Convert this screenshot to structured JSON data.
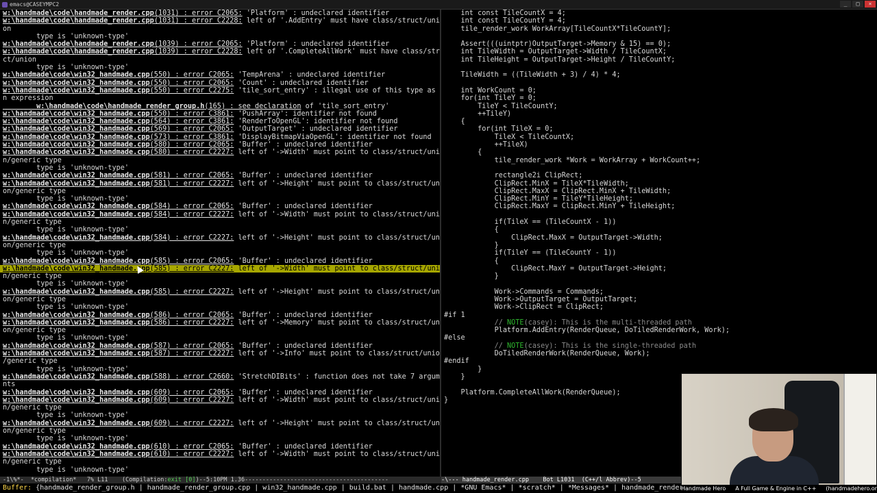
{
  "window": {
    "title": "emacs@CASEYMPC2",
    "btn_min": "_",
    "btn_max": "□",
    "btn_close": "×"
  },
  "left_lines": [
    {
      "t": "err",
      "path": "w:\\handmade\\code\\handmade_render.cpp",
      "loc": "(1031) : error C2065:",
      "msg": " 'Platform' : undeclared identifier"
    },
    {
      "t": "err",
      "path": "w:\\handmade\\code\\handmade_render.cpp",
      "loc": "(1031) : error C2228:",
      "msg": " left of '.AddEntry' must have class/struct/union"
    },
    {
      "t": "txt",
      "text": "on"
    },
    {
      "t": "txt",
      "text": "        type is 'unknown-type'"
    },
    {
      "t": "err",
      "path": "w:\\handmade\\code\\handmade_render.cpp",
      "loc": "(1039) : error C2065:",
      "msg": " 'Platform' : undeclared identifier"
    },
    {
      "t": "err",
      "path": "w:\\handmade\\code\\handmade_render.cpp",
      "loc": "(1039) : error C2228:",
      "msg": " left of '.CompleteAllWork' must have class/stru"
    },
    {
      "t": "txt",
      "text": "ct/union"
    },
    {
      "t": "txt",
      "text": "        type is 'unknown-type'"
    },
    {
      "t": "err",
      "path": "w:\\handmade\\code\\win32_handmade.cpp",
      "loc": "(550) : error C2065:",
      "msg": " 'TempArena' : undeclared identifier"
    },
    {
      "t": "err",
      "path": "w:\\handmade\\code\\win32_handmade.cpp",
      "loc": "(550) : error C2065:",
      "msg": " 'Count' : undeclared identifier"
    },
    {
      "t": "err",
      "path": "w:\\handmade\\code\\win32_handmade.cpp",
      "loc": "(550) : error C2275:",
      "msg": " 'tile_sort_entry' : illegal use of this type as a"
    },
    {
      "t": "txt",
      "text": "n expression"
    },
    {
      "t": "err",
      "path": "        w:\\handmade\\code\\handmade_render_group.h",
      "loc": "(165) : see declaration",
      "msg": " of 'tile_sort_entry'"
    },
    {
      "t": "err",
      "path": "w:\\handmade\\code\\win32_handmade.cpp",
      "loc": "(550) : error C3861:",
      "msg": " 'PushArray': identifier not found"
    },
    {
      "t": "err",
      "path": "w:\\handmade\\code\\win32_handmade.cpp",
      "loc": "(564) : error C3861:",
      "msg": " 'RenderToOpenGL': identifier not found"
    },
    {
      "t": "err",
      "path": "w:\\handmade\\code\\win32_handmade.cpp",
      "loc": "(569) : error C2065:",
      "msg": " 'OutputTarget' : undeclared identifier"
    },
    {
      "t": "err",
      "path": "w:\\handmade\\code\\win32_handmade.cpp",
      "loc": "(573) : error C3861:",
      "msg": " 'DisplayBitmapViaOpenGL': identifier not found"
    },
    {
      "t": "err",
      "path": "w:\\handmade\\code\\win32_handmade.cpp",
      "loc": "(580) : error C2065:",
      "msg": " 'Buffer' : undeclared identifier"
    },
    {
      "t": "err",
      "path": "w:\\handmade\\code\\win32_handmade.cpp",
      "loc": "(580) : error C2227:",
      "msg": " left of '->Width' must point to class/struct/unio"
    },
    {
      "t": "txt",
      "text": "n/generic type"
    },
    {
      "t": "txt",
      "text": "        type is 'unknown-type'"
    },
    {
      "t": "err",
      "path": "w:\\handmade\\code\\win32_handmade.cpp",
      "loc": "(581) : error C2065:",
      "msg": " 'Buffer' : undeclared identifier"
    },
    {
      "t": "err",
      "path": "w:\\handmade\\code\\win32_handmade.cpp",
      "loc": "(581) : error C2227:",
      "msg": " left of '->Height' must point to class/struct/uni"
    },
    {
      "t": "txt",
      "text": "on/generic type"
    },
    {
      "t": "txt",
      "text": "        type is 'unknown-type'"
    },
    {
      "t": "err",
      "path": "w:\\handmade\\code\\win32_handmade.cpp",
      "loc": "(584) : error C2065:",
      "msg": " 'Buffer' : undeclared identifier"
    },
    {
      "t": "err",
      "path": "w:\\handmade\\code\\win32_handmade.cpp",
      "loc": "(584) : error C2227:",
      "msg": " left of '->Width' must point to class/struct/unio"
    },
    {
      "t": "txt",
      "text": "n/generic type"
    },
    {
      "t": "txt",
      "text": "        type is 'unknown-type'"
    },
    {
      "t": "err",
      "path": "w:\\handmade\\code\\win32_handmade.cpp",
      "loc": "(584) : error C2227:",
      "msg": " left of '->Height' must point to class/struct/uni"
    },
    {
      "t": "txt",
      "text": "on/generic type"
    },
    {
      "t": "txt",
      "text": "        type is 'unknown-type'"
    },
    {
      "t": "err",
      "path": "w:\\handmade\\code\\win32_handmade.cpp",
      "loc": "(585) : error C2065:",
      "msg": " 'Buffer' : undeclared identifier"
    },
    {
      "t": "err",
      "hl": true,
      "path": "w:\\handmade\\code\\win32_handmade.cpp",
      "loc": "(585) : error C2227:",
      "msg": " left of '->Width' must point to class/struct/unio"
    },
    {
      "t": "txt",
      "text": "n/generic type"
    },
    {
      "t": "txt",
      "text": "        type is 'unknown-type'"
    },
    {
      "t": "err",
      "path": "w:\\handmade\\code\\win32_handmade.cpp",
      "loc": "(585) : error C2227:",
      "msg": " left of '->Height' must point to class/struct/uni"
    },
    {
      "t": "txt",
      "text": "on/generic type"
    },
    {
      "t": "txt",
      "text": "        type is 'unknown-type'"
    },
    {
      "t": "err",
      "path": "w:\\handmade\\code\\win32_handmade.cpp",
      "loc": "(586) : error C2065:",
      "msg": " 'Buffer' : undeclared identifier"
    },
    {
      "t": "err",
      "path": "w:\\handmade\\code\\win32_handmade.cpp",
      "loc": "(586) : error C2227:",
      "msg": " left of '->Memory' must point to class/struct/uni"
    },
    {
      "t": "txt",
      "text": "on/generic type"
    },
    {
      "t": "txt",
      "text": "        type is 'unknown-type'"
    },
    {
      "t": "err",
      "path": "w:\\handmade\\code\\win32_handmade.cpp",
      "loc": "(587) : error C2065:",
      "msg": " 'Buffer' : undeclared identifier"
    },
    {
      "t": "err",
      "path": "w:\\handmade\\code\\win32_handmade.cpp",
      "loc": "(587) : error C2227:",
      "msg": " left of '->Info' must point to class/struct/union"
    },
    {
      "t": "txt",
      "text": "/generic type"
    },
    {
      "t": "txt",
      "text": "        type is 'unknown-type'"
    },
    {
      "t": "err",
      "path": "w:\\handmade\\code\\win32_handmade.cpp",
      "loc": "(588) : error C2660:",
      "msg": " 'StretchDIBits' : function does not take 7 argume"
    },
    {
      "t": "txt",
      "text": "nts"
    },
    {
      "t": "err",
      "path": "w:\\handmade\\code\\win32_handmade.cpp",
      "loc": "(609) : error C2065:",
      "msg": " 'Buffer' : undeclared identifier"
    },
    {
      "t": "err",
      "path": "w:\\handmade\\code\\win32_handmade.cpp",
      "loc": "(609) : error C2227:",
      "msg": " left of '->Width' must point to class/struct/unio"
    },
    {
      "t": "txt",
      "text": "n/generic type"
    },
    {
      "t": "txt",
      "text": "        type is 'unknown-type'"
    },
    {
      "t": "err",
      "path": "w:\\handmade\\code\\win32_handmade.cpp",
      "loc": "(609) : error C2227:",
      "msg": " left of '->Height' must point to class/struct/uni"
    },
    {
      "t": "txt",
      "text": "on/generic type"
    },
    {
      "t": "txt",
      "text": "        type is 'unknown-type'"
    },
    {
      "t": "err",
      "path": "w:\\handmade\\code\\win32_handmade.cpp",
      "loc": "(610) : error C2065:",
      "msg": " 'Buffer' : undeclared identifier"
    },
    {
      "t": "err",
      "path": "w:\\handmade\\code\\win32_handmade.cpp",
      "loc": "(610) : error C2227:",
      "msg": " left of '->Width' must point to class/struct/unio"
    },
    {
      "t": "txt",
      "text": "n/generic type"
    },
    {
      "t": "txt",
      "text": "        type is 'unknown-type'"
    }
  ],
  "right_lines": [
    {
      "text": "    int const TileCountX = 4;"
    },
    {
      "text": "    int const TileCountY = 4;"
    },
    {
      "text": "    tile_render_work WorkArray[TileCountX*TileCountY];"
    },
    {
      "text": ""
    },
    {
      "text": "    Assert(((uintptr)OutputTarget->Memory & 15) == 0);"
    },
    {
      "text": "    int TileWidth = OutputTarget->Width / TileCountX;"
    },
    {
      "text": "    int TileHeight = OutputTarget->Height / TileCountY;"
    },
    {
      "text": ""
    },
    {
      "text": "    TileWidth = ((TileWidth + 3) / 4) * 4;"
    },
    {
      "text": ""
    },
    {
      "text": "    int WorkCount = 0;"
    },
    {
      "text": "    for(int TileY = 0;"
    },
    {
      "text": "        TileY < TileCountY;"
    },
    {
      "text": "        ++TileY)"
    },
    {
      "text": "    {"
    },
    {
      "text": "        for(int TileX = 0;"
    },
    {
      "text": "            TileX < TileCountX;"
    },
    {
      "text": "            ++TileX)"
    },
    {
      "text": "        {"
    },
    {
      "text": "            tile_render_work *Work = WorkArray + WorkCount++;"
    },
    {
      "text": ""
    },
    {
      "text": "            rectangle2i ClipRect;"
    },
    {
      "text": "            ClipRect.MinX = TileX*TileWidth;"
    },
    {
      "text": "            ClipRect.MaxX = ClipRect.MinX + TileWidth;"
    },
    {
      "text": "            ClipRect.MinY = TileY*TileHeight;"
    },
    {
      "text": "            ClipRect.MaxY = ClipRect.MinY + TileHeight;"
    },
    {
      "text": ""
    },
    {
      "text": "            if(TileX == (TileCountX - 1))"
    },
    {
      "text": "            {"
    },
    {
      "text": "                ClipRect.MaxX = OutputTarget->Width;"
    },
    {
      "text": "            }"
    },
    {
      "text": "            if(TileY == (TileCountY - 1))"
    },
    {
      "text": "            {"
    },
    {
      "text": "                ClipRect.MaxY = OutputTarget->Height;"
    },
    {
      "text": "            }"
    },
    {
      "text": ""
    },
    {
      "text": "            Work->Commands = Commands;"
    },
    {
      "text": "            Work->OutputTarget = OutputTarget;"
    },
    {
      "text": "            Work->ClipRect = ClipRect;"
    },
    {
      "text": "#if 1"
    },
    {
      "text": "            // NOTE(casey): This is the multi-threaded path",
      "c": "mt"
    },
    {
      "text": "            Platform.AddEntry(RenderQueue, DoTiledRenderWork, Work);"
    },
    {
      "text": "#else"
    },
    {
      "text": "            // NOTE(casey): This is the single-threaded path",
      "c": "st"
    },
    {
      "text": "            DoTiledRenderWork(RenderQueue, Work);"
    },
    {
      "text": "#endif"
    },
    {
      "text": "        }"
    },
    {
      "text": "    }"
    },
    {
      "text": ""
    },
    {
      "text": "    Platform.CompleteAllWork(RenderQueue);"
    },
    {
      "text": "}"
    }
  ],
  "modeline_left_a": "-1\\%*-  *compilation*   7% L11    (Compilation:",
  "modeline_left_exit": "exit [0]",
  "modeline_left_b": ")--5:10PM 1.36-----------------------------------------",
  "modeline_right": "-\\--- handmade_render.cpp    Bot L1031  (C++/l Abbrev)--5",
  "minibuffer_label": "Buffer:",
  "minibuffer_text": " {handmade_render_group.h | handmade_render_group.cpp | win32_handmade.cpp | build.bat | handmade.cpp | *GNU Emacs* | *scratch* | *Messages* | handmade_render",
  "caption": {
    "a": "Handmade Hero",
    "b": "A Full Game & Engine in C++",
    "c": "(handmadehero.org)"
  }
}
